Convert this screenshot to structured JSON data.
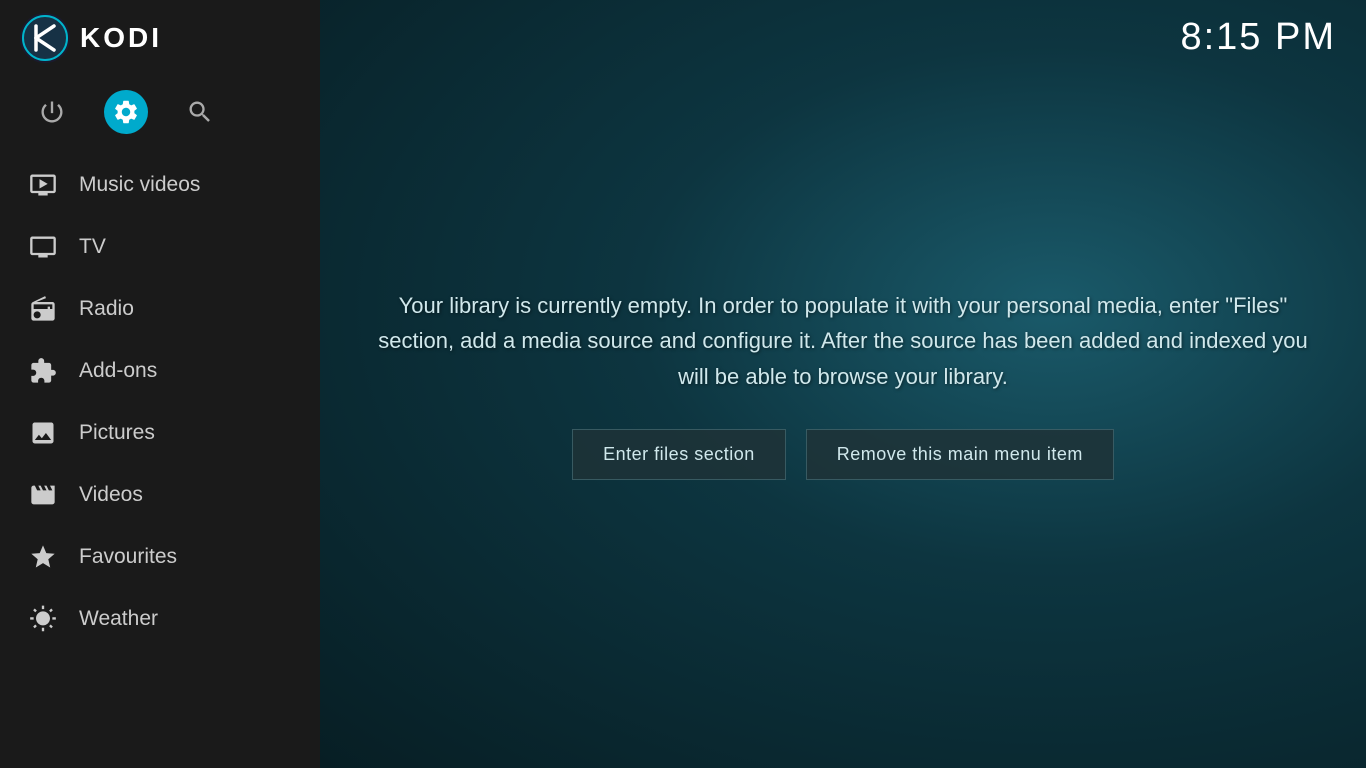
{
  "header": {
    "logo_alt": "KODI",
    "title": "KODI",
    "clock": "8:15 PM"
  },
  "sidebar": {
    "icons": [
      {
        "name": "power",
        "label": "Power",
        "active": false
      },
      {
        "name": "settings",
        "label": "Settings",
        "active": true
      },
      {
        "name": "search",
        "label": "Search",
        "active": false
      }
    ],
    "nav_items": [
      {
        "id": "music-videos",
        "label": "Music videos",
        "icon": "music-video-icon"
      },
      {
        "id": "tv",
        "label": "TV",
        "icon": "tv-icon"
      },
      {
        "id": "radio",
        "label": "Radio",
        "icon": "radio-icon"
      },
      {
        "id": "add-ons",
        "label": "Add-ons",
        "icon": "addons-icon"
      },
      {
        "id": "pictures",
        "label": "Pictures",
        "icon": "pictures-icon"
      },
      {
        "id": "videos",
        "label": "Videos",
        "icon": "videos-icon"
      },
      {
        "id": "favourites",
        "label": "Favourites",
        "icon": "favourites-icon"
      },
      {
        "id": "weather",
        "label": "Weather",
        "icon": "weather-icon"
      }
    ]
  },
  "main": {
    "library_message": "Your library is currently empty. In order to populate it with your personal media, enter \"Files\" section, add a media source and configure it. After the source has been added and indexed you will be able to browse your library.",
    "btn_enter_files": "Enter files section",
    "btn_remove_item": "Remove this main menu item"
  }
}
